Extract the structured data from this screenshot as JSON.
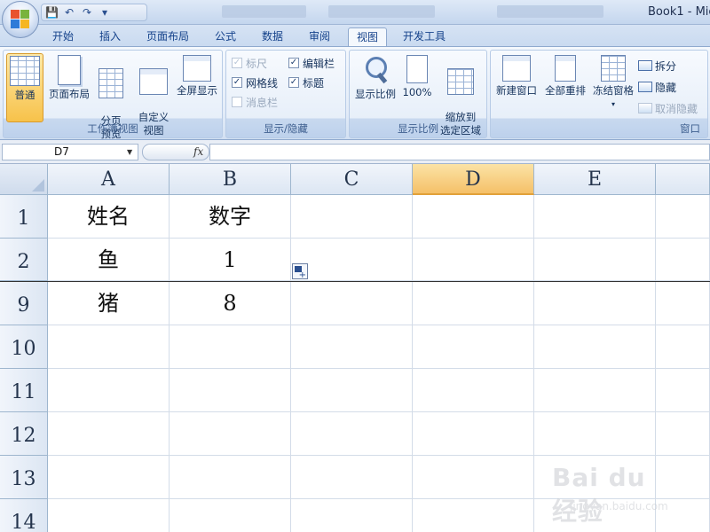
{
  "window": {
    "title": "Book1 - Mic"
  },
  "ribbon_tabs": [
    "开始",
    "插入",
    "页面布局",
    "公式",
    "数据",
    "审阅",
    "视图",
    "开发工具"
  ],
  "active_tab": "视图",
  "groups": {
    "workbook_views": {
      "label": "工作簿视图",
      "buttons": [
        "普通",
        "页面布局",
        "分页\n预览",
        "自定义\n视图",
        "全屏显示"
      ]
    },
    "show_hide": {
      "label": "显示/隐藏",
      "ruler": "标尺",
      "gridlines": "网格线",
      "message_bar": "消息栏",
      "formula_bar": "编辑栏",
      "headings": "标题"
    },
    "zoom": {
      "label": "显示比例",
      "zoom_button": "显示比例",
      "hundred_button": "100%",
      "zoom_selection_button": "缩放到\n选定区域"
    },
    "window_group": {
      "label": "窗口",
      "new_window": "新建窗口",
      "arrange_all": "全部重排",
      "freeze_panes": "冻结窗格",
      "split": "拆分",
      "hide": "隐藏",
      "unhide": "取消隐藏"
    }
  },
  "formula_bar": {
    "name_box": "D7",
    "fx": "fx",
    "formula": ""
  },
  "columns": [
    "A",
    "B",
    "C",
    "D",
    "E"
  ],
  "selected_column": "D",
  "rows": [
    {
      "num": "1",
      "a": "姓名",
      "b": "数字"
    },
    {
      "num": "2",
      "a": "鱼",
      "b": "1"
    },
    {
      "num": "9",
      "a": "猪",
      "b": "8"
    },
    {
      "num": "10",
      "a": "",
      "b": ""
    },
    {
      "num": "11",
      "a": "",
      "b": ""
    },
    {
      "num": "12",
      "a": "",
      "b": ""
    },
    {
      "num": "13",
      "a": "",
      "b": ""
    },
    {
      "num": "14",
      "a": "",
      "b": ""
    }
  ],
  "watermark": {
    "brand": "Bai du 经验",
    "url": "jingyan.baidu.com"
  }
}
